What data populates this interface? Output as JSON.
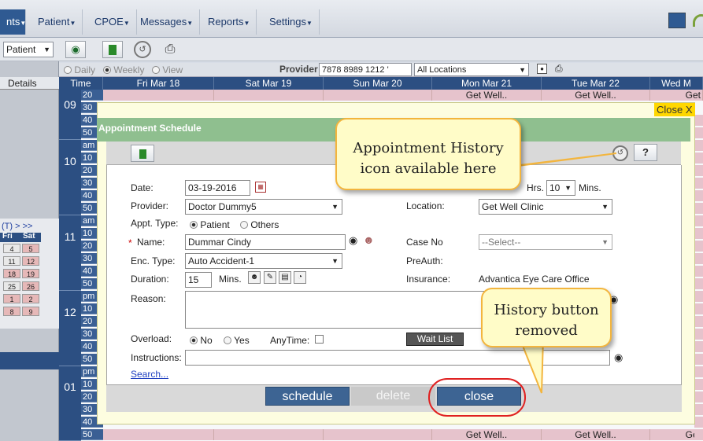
{
  "nav": {
    "items": [
      {
        "label": "nts"
      },
      {
        "label": "Patient"
      },
      {
        "label": "CPOE"
      },
      {
        "label": "Messages"
      },
      {
        "label": "Reports"
      },
      {
        "label": "Settings"
      }
    ]
  },
  "toolbar": {
    "patient_select": "Patient",
    "view_daily": "Daily",
    "view_weekly": "Weekly",
    "view_view": "View",
    "provider_label": "Provider",
    "provider_value": "7878 8989 1212 '",
    "location_value": "All Locations"
  },
  "sidebar": {
    "details_label": "Details",
    "mini_cal_nav": "(T)  >  >>",
    "mini_cal_head": [
      "Fri",
      "Sat"
    ],
    "mini_cal_rows": [
      [
        "4",
        "5"
      ],
      [
        "11",
        "12"
      ],
      [
        "18",
        "19"
      ],
      [
        "25",
        "26"
      ],
      [
        "1",
        "2"
      ],
      [
        "8",
        "9"
      ]
    ]
  },
  "calendar": {
    "time_header": "Time",
    "days": [
      "Fri Mar 18",
      "Sat Mar 19",
      "Sun Mar 20",
      "Mon Mar 21",
      "Tue Mar 22",
      "Wed M"
    ],
    "hours": [
      "09",
      "10",
      "11",
      "12",
      "01"
    ],
    "event_label": "Get Well..",
    "top_slots": [
      "20",
      "30",
      "40",
      "50"
    ],
    "am_slots": [
      "am",
      "10",
      "20",
      "30",
      "40",
      "50"
    ],
    "pm_slots": [
      "pm",
      "10",
      "20",
      "30",
      "40",
      "50"
    ],
    "right_col": "Get"
  },
  "dialog": {
    "close_x": "Close X",
    "title": "Appointment Schedule",
    "help_button": "?",
    "date_label": "Date:",
    "date_value": "03-19-2016",
    "hrs_label": "Hrs.",
    "mins_value": "10",
    "mins_label": "Mins.",
    "provider_label": "Provider:",
    "provider_value": "Doctor Dummy5",
    "location_label": "Location:",
    "location_value": "Get Well Clinic",
    "appt_type_label": "Appt. Type:",
    "appt_type_patient": "Patient",
    "appt_type_others": "Others",
    "required_marker": "*",
    "name_label": "Name:",
    "name_value": "Dummar Cindy",
    "case_no_label": "Case No",
    "case_no_value": "--Select--",
    "enc_type_label": "Enc. Type:",
    "enc_type_value": "Auto Accident-1",
    "preauth_label": "PreAuth:",
    "duration_label": "Duration:",
    "duration_value": "15",
    "duration_unit": "Mins.",
    "insurance_label": "Insurance:",
    "insurance_value": "Advantica Eye Care Office",
    "reason_label": "Reason:",
    "overload_label": "Overload:",
    "overload_no": "No",
    "overload_yes": "Yes",
    "anytime_label": "AnyTime:",
    "wait_list_button": "Wait List",
    "instructions_label": "Instructions:",
    "search_link": "Search...",
    "schedule_button": "schedule",
    "delete_button": "delete",
    "close_button": "close"
  },
  "callouts": {
    "history_icon": "Appointment History icon available here",
    "history_button": "History button removed"
  },
  "colors": {
    "nav_active": "#2f5a92",
    "dialog_header": "#8fbf8f",
    "event_fill": "#e6c3cc",
    "callout_border": "#f3b53e",
    "highlight_ring": "#e02020"
  }
}
